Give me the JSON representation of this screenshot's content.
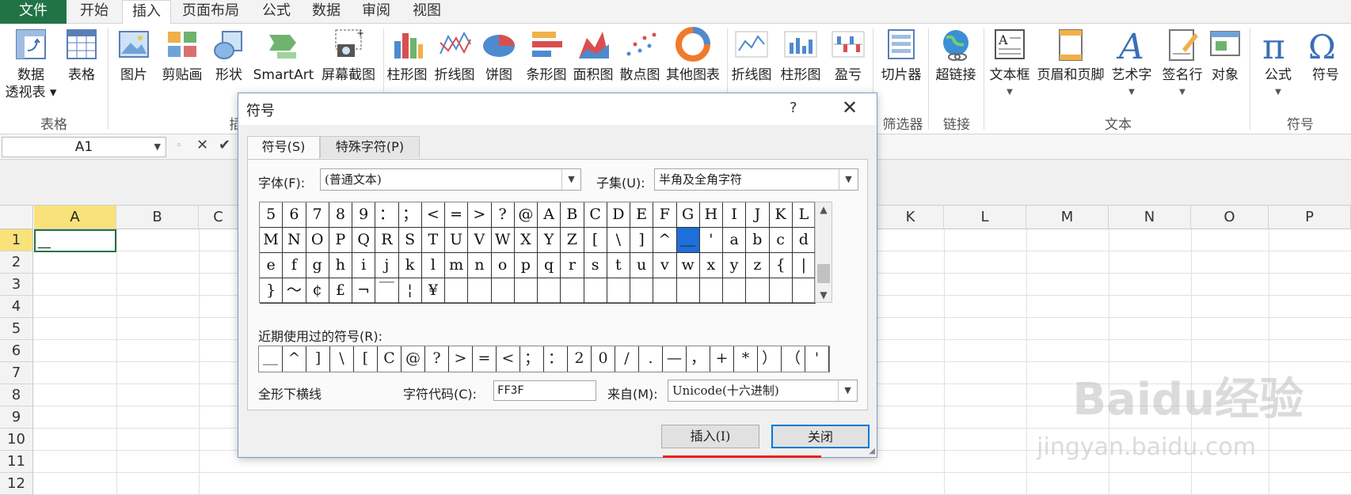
{
  "tabs": [
    "文件",
    "开始",
    "插入",
    "页面布局",
    "公式",
    "数据",
    "审阅",
    "视图"
  ],
  "ribbon": {
    "buttons": [
      {
        "label": "数据",
        "label2": "透视表 ▾",
        "icon": "pivot-table-icon"
      },
      {
        "label": "表格",
        "icon": "table-icon"
      },
      {
        "label": "图片",
        "icon": "picture-icon"
      },
      {
        "label": "剪贴画",
        "icon": "clipart-icon"
      },
      {
        "label": "形状",
        "icon": "shapes-icon"
      },
      {
        "label": "SmartArt",
        "icon": "smartart-icon"
      },
      {
        "label": "屏幕截图",
        "icon": "screenshot-icon"
      },
      {
        "label": "柱形图",
        "icon": "column-chart-icon"
      },
      {
        "label": "折线图",
        "icon": "line-chart-icon"
      },
      {
        "label": "饼图",
        "icon": "pie-chart-icon"
      },
      {
        "label": "条形图",
        "icon": "bar-chart-icon"
      },
      {
        "label": "面积图",
        "icon": "area-chart-icon"
      },
      {
        "label": "散点图",
        "icon": "scatter-chart-icon"
      },
      {
        "label": "其他图表",
        "icon": "other-charts-icon"
      },
      {
        "label": "折线图",
        "icon": "sparkline-line-icon"
      },
      {
        "label": "柱形图",
        "icon": "sparkline-column-icon"
      },
      {
        "label": "盈亏",
        "icon": "win-loss-icon"
      },
      {
        "label": "切片器",
        "icon": "slicer-icon"
      },
      {
        "label": "超链接",
        "icon": "hyperlink-icon"
      },
      {
        "label": "文本框",
        "icon": "textbox-icon"
      },
      {
        "label": "页眉和页脚",
        "icon": "header-footer-icon"
      },
      {
        "label": "艺术字",
        "icon": "wordart-icon"
      },
      {
        "label": "签名行",
        "icon": "signature-line-icon"
      },
      {
        "label": "对象",
        "icon": "object-icon"
      },
      {
        "label": "公式",
        "icon": "equation-icon"
      },
      {
        "label": "符号",
        "icon": "symbol-icon"
      }
    ],
    "groups": [
      "表格",
      "插",
      "筛选器",
      "链接",
      "文本",
      "符号"
    ]
  },
  "formula_bar": {
    "name_box": "A1"
  },
  "columns": [
    "A",
    "B",
    "C",
    "K",
    "L",
    "M",
    "N",
    "O",
    "P"
  ],
  "rows": [
    "1",
    "2",
    "3",
    "4",
    "5",
    "6",
    "7",
    "8",
    "9",
    "10",
    "11",
    "12"
  ],
  "cell_a1": "__",
  "dialog": {
    "title": "符号",
    "help": "?",
    "close": "✕",
    "tab_symbols": "符号(S)",
    "tab_special": "特殊字符(P)",
    "font_label": "字体(F):",
    "font_value": "(普通文本)",
    "subset_label": "子集(U):",
    "subset_value": "半角及全角字符",
    "symbols": [
      [
        "5",
        "6",
        "7",
        "8",
        "9",
        "：",
        "；",
        "<",
        "=",
        ">",
        "?",
        "@",
        "A",
        "B",
        "C",
        "D",
        "E",
        "F",
        "G",
        "H",
        "I",
        "J",
        "K",
        "L"
      ],
      [
        "M",
        "N",
        "O",
        "P",
        "Q",
        "R",
        "S",
        "T",
        "U",
        "V",
        "W",
        "X",
        "Y",
        "Z",
        "[",
        "\\",
        "]",
        "^",
        "＿",
        "'",
        "a",
        "b",
        "c",
        "d"
      ],
      [
        "e",
        "f",
        "g",
        "h",
        "i",
        "j",
        "k",
        "l",
        "m",
        "n",
        "o",
        "p",
        "q",
        "r",
        "s",
        "t",
        "u",
        "v",
        "w",
        "x",
        "y",
        "z",
        "{",
        "|"
      ],
      [
        "}",
        "～",
        "¢",
        "£",
        "¬",
        "￣",
        "¦",
        "¥",
        "",
        "",
        "",
        "",
        "",
        "",
        "",
        "",
        "",
        "",
        "",
        "",
        "",
        "",
        "",
        ""
      ]
    ],
    "selected_row": 1,
    "selected_col": 18,
    "recent_label": "近期使用过的符号(R):",
    "recent": [
      "＿",
      "^",
      "]",
      "\\",
      "[",
      "C",
      "@",
      "?",
      ">",
      "=",
      "<",
      "；",
      "：",
      "2",
      "0",
      "/",
      ".",
      "—",
      "，",
      "+",
      "*",
      "）",
      "（",
      "'"
    ],
    "char_name": "全形下横线",
    "code_label": "字符代码(C):",
    "code_value": "FF3F",
    "from_label": "来自(M):",
    "from_value": "Unicode(十六进制)",
    "insert_button": "插入(I)",
    "close_button": "关闭"
  },
  "watermark": "Baidu经验",
  "watermark2": "jingyan.baidu.com"
}
